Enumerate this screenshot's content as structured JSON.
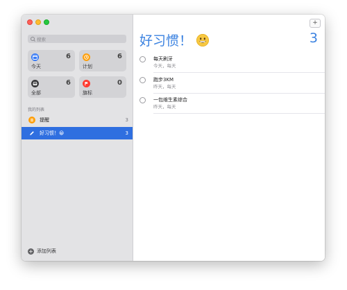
{
  "sidebar": {
    "search_placeholder": "搜索",
    "smart_lists": [
      {
        "label": "今天",
        "count": "6",
        "color": "#3478f6",
        "icon": "calendar-icon"
      },
      {
        "label": "计划",
        "count": "6",
        "color": "#ff9f0a",
        "icon": "clock-icon"
      },
      {
        "label": "全部",
        "count": "6",
        "color": "#3a3a3c",
        "icon": "tray-icon"
      },
      {
        "label": "旗标",
        "count": "0",
        "color": "#ff3b30",
        "icon": "flag-icon"
      }
    ],
    "my_lists_title": "我的列表",
    "lists": [
      {
        "name": "提醒",
        "count": "3",
        "color": "#ff9f0a",
        "icon": "list-icon"
      },
      {
        "name": "好习惯！😀",
        "count": "3",
        "color": "#2f6fe0",
        "icon": "pencil-icon"
      }
    ],
    "add_list_label": "添加列表"
  },
  "main": {
    "add_button": "+",
    "title": "好习惯！",
    "emoji_icon": "grinning-face-icon",
    "count": "3",
    "accent": "#3b82e0",
    "tasks": [
      {
        "title": "每天刷牙",
        "subtitle": "今天，每天"
      },
      {
        "title": "跑步3KM",
        "subtitle": "昨天，每天"
      },
      {
        "title": "一包维生素综合",
        "subtitle": "昨天，每天"
      }
    ]
  }
}
